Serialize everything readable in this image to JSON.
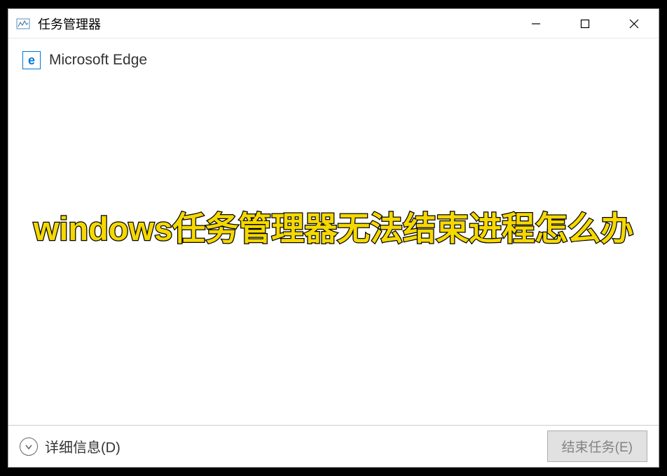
{
  "window": {
    "title": "任务管理器"
  },
  "process": {
    "name": "Microsoft Edge",
    "icon_letter": "e"
  },
  "overlay": {
    "text": "windows任务管理器无法结束进程怎么办"
  },
  "footer": {
    "details_label": "详细信息(D)",
    "end_task_label": "结束任务(E)"
  }
}
